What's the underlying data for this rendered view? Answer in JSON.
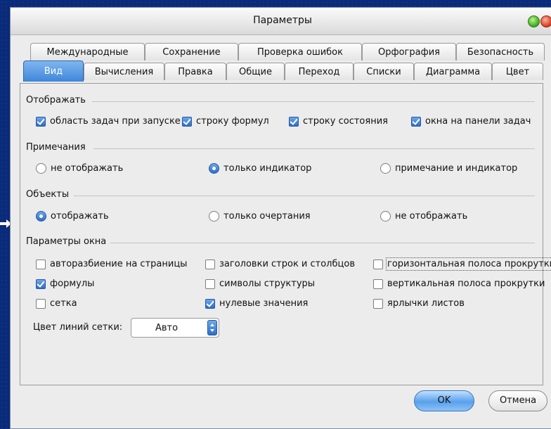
{
  "window": {
    "title": "Параметры"
  },
  "tabs_row1": [
    "Международные",
    "Сохранение",
    "Проверка ошибок",
    "Орфография",
    "Безопасность"
  ],
  "tabs_row2": [
    "Вид",
    "Вычисления",
    "Правка",
    "Общие",
    "Переход",
    "Списки",
    "Диаграмма",
    "Цвет"
  ],
  "active_tab": "Вид",
  "show": {
    "title": "Отображать",
    "items": [
      {
        "label": "область задач при запуске",
        "checked": true
      },
      {
        "label": "строку формул",
        "checked": true
      },
      {
        "label": "строку состояния",
        "checked": true
      },
      {
        "label": "окна на панели задач",
        "checked": true
      }
    ]
  },
  "comments": {
    "title": "Примечания",
    "options": [
      {
        "label": "не отображать",
        "selected": false
      },
      {
        "label": "только индикатор",
        "selected": true
      },
      {
        "label": "примечание и индикатор",
        "selected": false
      }
    ]
  },
  "objects": {
    "title": "Объекты",
    "options": [
      {
        "label": "отображать",
        "selected": true
      },
      {
        "label": "только очертания",
        "selected": false
      },
      {
        "label": "не отображать",
        "selected": false
      }
    ]
  },
  "window_options": {
    "title": "Параметры окна",
    "items": [
      {
        "label": "авторазбиение на страницы",
        "checked": false
      },
      {
        "label": "заголовки строк и столбцов",
        "checked": false
      },
      {
        "label": "горизонтальная полоса прокрутки",
        "checked": false
      },
      {
        "label": "формулы",
        "checked": true
      },
      {
        "label": "символы структуры",
        "checked": false
      },
      {
        "label": "вертикальная полоса прокрутки",
        "checked": false
      },
      {
        "label": "сетка",
        "checked": false
      },
      {
        "label": "нулевые значения",
        "checked": true
      },
      {
        "label": "ярлычки листов",
        "checked": false
      }
    ],
    "gridline_color_label": "Цвет линий сетки:",
    "gridline_color_value": "Авто"
  },
  "buttons": {
    "ok": "OK",
    "cancel": "Отмена"
  },
  "colors": {
    "accent": "#3f86da",
    "desktop": "#0a2a7a"
  }
}
